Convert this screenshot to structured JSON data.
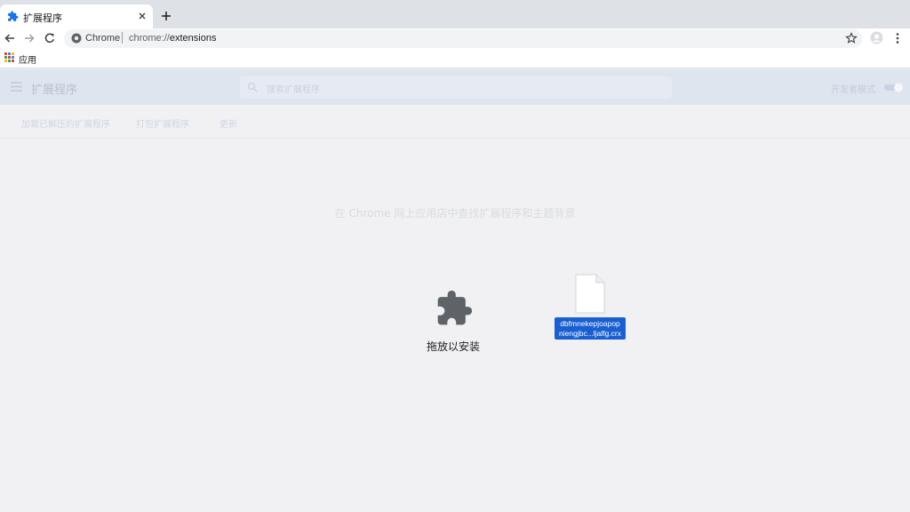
{
  "tab": {
    "title": "扩展程序",
    "favicon": "puzzle-icon"
  },
  "omnibox": {
    "site_label": "Chrome",
    "url_scheme": "chrome://",
    "url_host": "extensions"
  },
  "bookmarks": {
    "apps_label": "应用"
  },
  "extensions_page": {
    "title": "扩展程序",
    "search_placeholder": "搜索扩展程序",
    "developer_mode_label": "开发者模式",
    "developer_mode_enabled": true,
    "actions": [
      "加载已解压的扩展程序",
      "打包扩展程序",
      "更新"
    ],
    "empty_message": "在 Chrome 网上应用店中查找扩展程序和主题背景"
  },
  "drop_overlay": {
    "label": "拖放以安装",
    "icon": "puzzle-icon"
  },
  "dragged_file": {
    "name_line1": "dbfmnekepjoapop",
    "name_line2": "niengjbc...ljalfg.crx"
  },
  "colors": {
    "accent": "#1a73e8",
    "selection": "#1a5fd1",
    "header_faded": "#dfe5ef"
  }
}
